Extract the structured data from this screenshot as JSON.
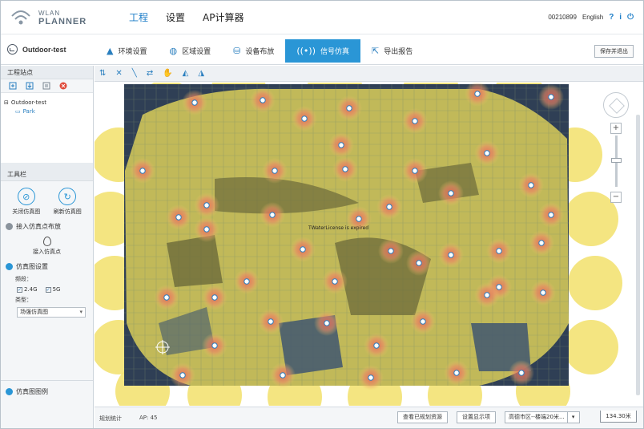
{
  "header": {
    "logo_line1": "WLAN",
    "logo_line2": "PLANNER",
    "nav": [
      "工程",
      "设置",
      "AP计算器"
    ],
    "user_id": "00210899",
    "language": "English",
    "help_icon": "?",
    "info_icon": "i"
  },
  "project": {
    "title": "Outdoor-test",
    "tabs": [
      {
        "label": "环境设置",
        "icon": "warning-triangle-icon"
      },
      {
        "label": "区域设置",
        "icon": "globe-icon"
      },
      {
        "label": "设备布放",
        "icon": "device-icon"
      },
      {
        "label": "信号仿真",
        "icon": "signal-icon"
      },
      {
        "label": "导出报告",
        "icon": "export-icon"
      }
    ],
    "active_tab": 3,
    "save_exit_label": "保存并退出"
  },
  "left": {
    "sites_title": "工程站点",
    "tree_root": "Outdoor-test",
    "tree_child": "Park",
    "toolbox_title": "工具栏",
    "close_sim_label": "关闭仿真图",
    "refresh_sim_label": "刷新仿真图",
    "access_section": "接入仿真点布放",
    "access_point_label": "接入仿真点",
    "sim_settings": "仿真图设置",
    "band_label": "频段：",
    "band_24": "2.4G",
    "band_5": "5G",
    "type_label": "类型：",
    "type_value": "场强仿真图",
    "legend_title": "仿真图图例"
  },
  "map": {
    "watermark": "TWaterLicense is expired"
  },
  "status": {
    "plan_stats": "规划统计",
    "ap_count": "AP: 45",
    "view_resources": "查看已规划资源",
    "display_settings": "设置显示项",
    "map_source": "高德市区--楼端20米...",
    "scale": "134.30米"
  },
  "colors": {
    "accent": "#2a96d6",
    "heat_yellow": "#f2e06b",
    "heat_red": "#e86b5a",
    "map_dark": "#2f3f55"
  }
}
